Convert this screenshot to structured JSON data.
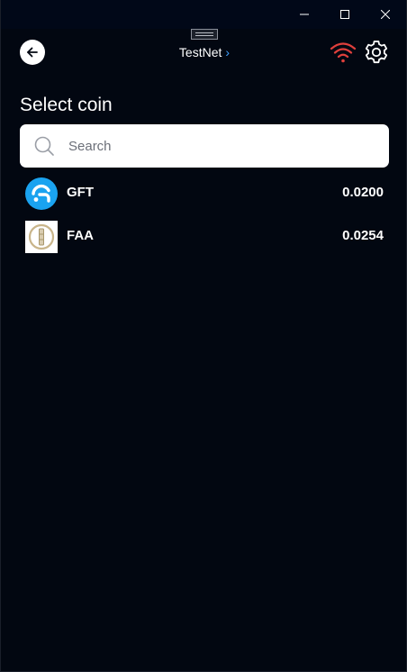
{
  "window": {
    "controls": [
      "minimize",
      "maximize",
      "close"
    ]
  },
  "header": {
    "network_label": "TestNet",
    "network_chevron": "›",
    "back_icon": "arrow-left-icon",
    "status_icon": "wifi-icon",
    "status_color": "#e0403c",
    "settings_icon": "gear-icon"
  },
  "page": {
    "title": "Select coin"
  },
  "search": {
    "placeholder": "Search",
    "value": ""
  },
  "coins": [
    {
      "symbol": "GFT",
      "balance": "0.0200",
      "logo_color": "#1aa3f0"
    },
    {
      "symbol": "FAA",
      "balance": "0.0254",
      "logo_color": "#c9b58a"
    }
  ],
  "colors": {
    "background": "#020711",
    "accent": "#3ea0ff",
    "text": "#ffffff"
  }
}
